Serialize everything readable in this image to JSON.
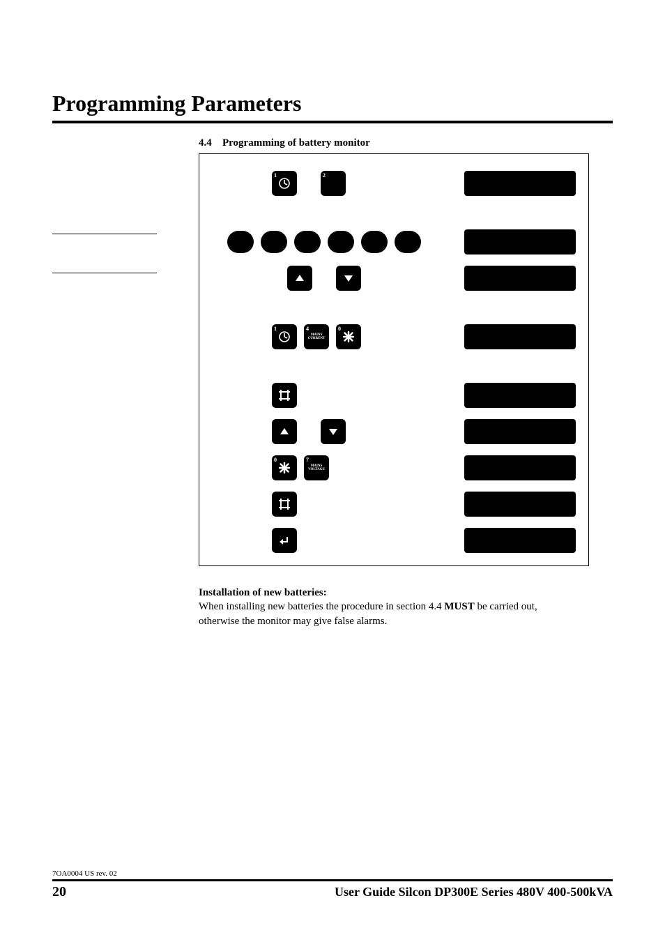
{
  "heading": "Programming Parameters",
  "section": {
    "number": "4.4",
    "title": "Programming of battery monitor"
  },
  "diagram": {
    "keys": {
      "clock": {
        "corner": "1"
      },
      "blank2": {
        "corner": "2"
      },
      "mains_current": {
        "corner": "4",
        "line1": "MAINS",
        "line2": "CURRENT"
      },
      "star": {
        "corner": "0"
      },
      "mains_voltage": {
        "corner": "7",
        "line1": "MAINS",
        "line2": "VOLTAGE"
      }
    }
  },
  "body": {
    "subheading": "Installation of new batteries:",
    "line1_a": "When installing new batteries the procedure in section 4.4 ",
    "line1_b": "MUST",
    "line1_c": " be carried out,",
    "line2": "otherwise the monitor may give false alarms."
  },
  "footer": {
    "rev": "7OA0004 US rev. 02",
    "pagenum": "20",
    "title": "User Guide Silcon DP300E Series 480V 400-500kVA"
  }
}
